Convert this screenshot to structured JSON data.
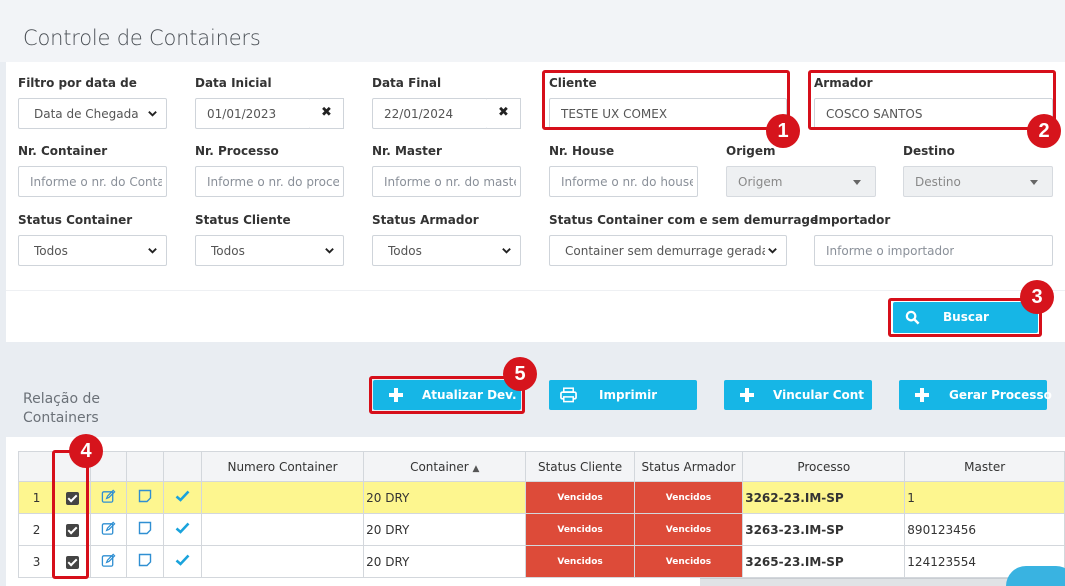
{
  "page": {
    "title": "Controle de Containers"
  },
  "filters": {
    "filtro_data": {
      "label": "Filtro por data de",
      "value": "Data de Chegada"
    },
    "data_inicial": {
      "label": "Data Inicial",
      "value": "01/01/2023"
    },
    "data_final": {
      "label": "Data Final",
      "value": "22/01/2024"
    },
    "cliente": {
      "label": "Cliente",
      "value": "TESTE UX COMEX"
    },
    "armador": {
      "label": "Armador",
      "value": "COSCO SANTOS"
    },
    "nr_container": {
      "label": "Nr. Container",
      "placeholder": "Informe o nr. do Contai"
    },
    "nr_processo": {
      "label": "Nr. Processo",
      "placeholder": "Informe o nr. do proces"
    },
    "nr_master": {
      "label": "Nr. Master",
      "placeholder": "Informe o nr. do master"
    },
    "nr_house": {
      "label": "Nr. House",
      "placeholder": "Informe o nr. do house"
    },
    "origem": {
      "label": "Origem",
      "placeholder": "Origem"
    },
    "destino": {
      "label": "Destino",
      "placeholder": "Destino"
    },
    "status_container": {
      "label": "Status Container",
      "value": "Todos"
    },
    "status_cliente": {
      "label": "Status Cliente",
      "value": "Todos"
    },
    "status_armador": {
      "label": "Status Armador",
      "value": "Todos"
    },
    "status_demurrage": {
      "label": "Status Container com e sem demurrage",
      "value": "Container sem demurrage gerada"
    },
    "importador": {
      "label": "Importador",
      "placeholder": "Informe o importador"
    }
  },
  "buttons": {
    "buscar": "Buscar",
    "atualizar": "Atualizar Dev...",
    "imprimir": "Imprimir",
    "vincular": "Vincular Cont...",
    "gerar": "Gerar Processo"
  },
  "badges": [
    "1",
    "2",
    "3",
    "4",
    "5"
  ],
  "section": {
    "line1": "Relação de",
    "line2": "Containers"
  },
  "table": {
    "headers": {
      "numero_container": "Numero Container",
      "container": "Container",
      "status_cliente": "Status Cliente",
      "status_armador": "Status Armador",
      "processo": "Processo",
      "master": "Master"
    },
    "rows": [
      {
        "n": "1",
        "numero": "",
        "container": "20 DRY",
        "status_cliente": "Vencidos",
        "status_armador": "Vencidos",
        "processo": "3262-23.IM-SP",
        "master": "1"
      },
      {
        "n": "2",
        "numero": "",
        "container": "20 DRY",
        "status_cliente": "Vencidos",
        "status_armador": "Vencidos",
        "processo": "3263-23.IM-SP",
        "master": "890123456"
      },
      {
        "n": "3",
        "numero": "",
        "container": "20 DRY",
        "status_cliente": "Vencidos",
        "status_armador": "Vencidos",
        "processo": "3265-23.IM-SP",
        "master": "124123554"
      }
    ]
  },
  "colors": {
    "accent": "#16b6e6",
    "highlight": "#d60f1a",
    "status_red": "#dd4b39",
    "row_highlight": "#fdf68f"
  },
  "icons": [
    "times-icon",
    "chevron-down-icon",
    "search-icon",
    "plus-icon",
    "print-icon",
    "edit-icon",
    "note-icon",
    "check-icon",
    "sort-icon",
    "caret-down-icon"
  ]
}
